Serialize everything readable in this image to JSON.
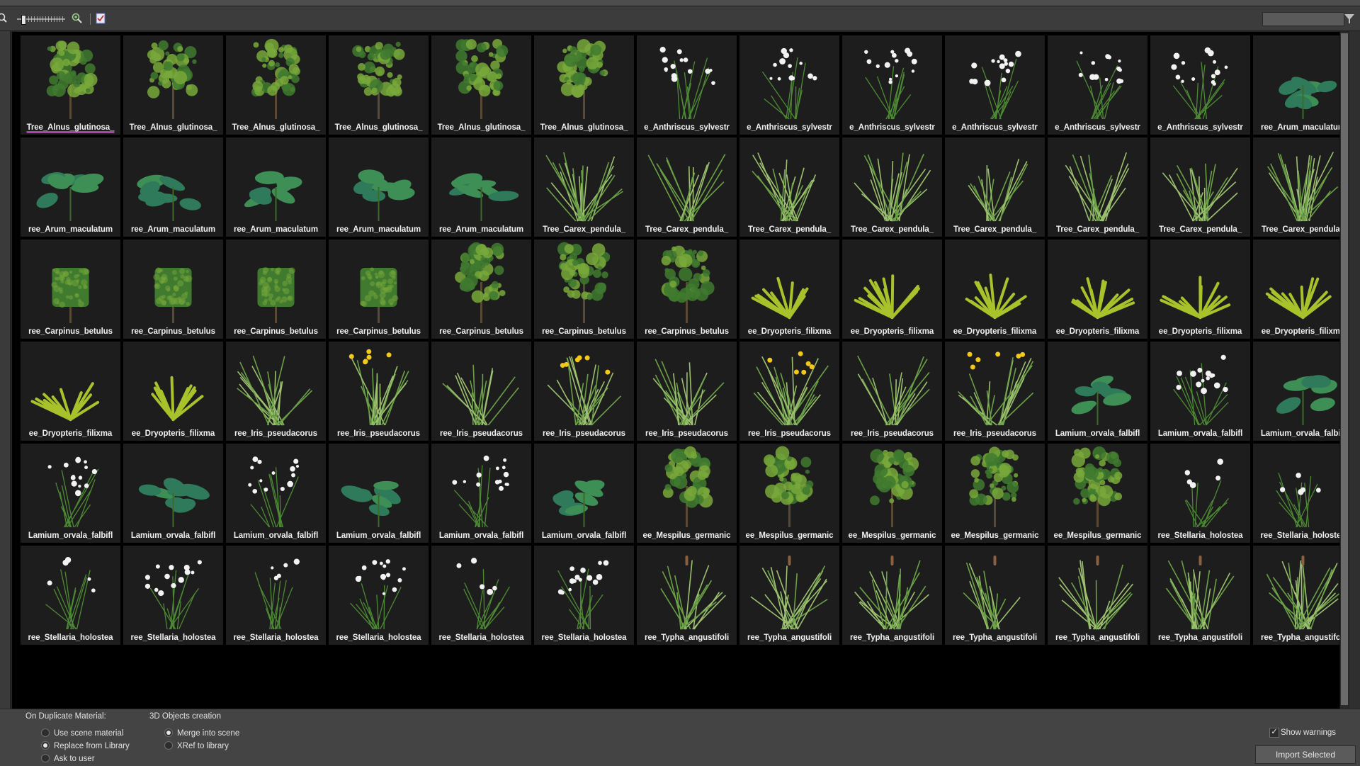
{
  "toolbar": {
    "icons": [
      "zoom-out-icon",
      "zoom-in-icon",
      "checkbox-list-icon",
      "filter-icon"
    ],
    "search": {
      "value": "",
      "placeholder": ""
    }
  },
  "grid": {
    "rows": [
      [
        {
          "label": "Tree_Alnus_glutinosa_",
          "kind": "tree",
          "selected": true
        },
        {
          "label": "Tree_Alnus_glutinosa_",
          "kind": "tree"
        },
        {
          "label": "Tree_Alnus_glutinosa_",
          "kind": "tree"
        },
        {
          "label": "Tree_Alnus_glutinosa_",
          "kind": "tree"
        },
        {
          "label": "Tree_Alnus_glutinosa_",
          "kind": "tree"
        },
        {
          "label": "Tree_Alnus_glutinosa_",
          "kind": "tree"
        },
        {
          "label": "e_Anthriscus_sylvestr",
          "kind": "flower"
        },
        {
          "label": "e_Anthriscus_sylvestr",
          "kind": "flower"
        },
        {
          "label": "e_Anthriscus_sylvestr",
          "kind": "flower"
        },
        {
          "label": "e_Anthriscus_sylvestr",
          "kind": "flower"
        },
        {
          "label": "e_Anthriscus_sylvestr",
          "kind": "flower"
        },
        {
          "label": "e_Anthriscus_sylvestr",
          "kind": "flower"
        },
        {
          "label": "ree_Arum_maculatum",
          "kind": "leafy"
        }
      ],
      [
        {
          "label": "ree_Arum_maculatum",
          "kind": "leafy"
        },
        {
          "label": "ree_Arum_maculatum",
          "kind": "leafy"
        },
        {
          "label": "ree_Arum_maculatum",
          "kind": "leafy"
        },
        {
          "label": "ree_Arum_maculatum",
          "kind": "leafy"
        },
        {
          "label": "ree_Arum_maculatum",
          "kind": "leafy"
        },
        {
          "label": "Tree_Carex_pendula_",
          "kind": "grass"
        },
        {
          "label": "Tree_Carex_pendula_",
          "kind": "grass"
        },
        {
          "label": "Tree_Carex_pendula_",
          "kind": "grass"
        },
        {
          "label": "Tree_Carex_pendula_",
          "kind": "grass"
        },
        {
          "label": "Tree_Carex_pendula_",
          "kind": "grass"
        },
        {
          "label": "Tree_Carex_pendula_",
          "kind": "grass"
        },
        {
          "label": "Tree_Carex_pendula_",
          "kind": "grass"
        },
        {
          "label": "Tree_Carex_pendula_",
          "kind": "grass"
        }
      ],
      [
        {
          "label": "ree_Carpinus_betulus",
          "kind": "hedge"
        },
        {
          "label": "ree_Carpinus_betulus",
          "kind": "hedge"
        },
        {
          "label": "ree_Carpinus_betulus",
          "kind": "hedge"
        },
        {
          "label": "ree_Carpinus_betulus",
          "kind": "hedge"
        },
        {
          "label": "ree_Carpinus_betulus",
          "kind": "tree"
        },
        {
          "label": "ree_Carpinus_betulus",
          "kind": "tree"
        },
        {
          "label": "ree_Carpinus_betulus",
          "kind": "tree"
        },
        {
          "label": "ee_Dryopteris_filixma",
          "kind": "fern"
        },
        {
          "label": "ee_Dryopteris_filixma",
          "kind": "fern"
        },
        {
          "label": "ee_Dryopteris_filixma",
          "kind": "fern"
        },
        {
          "label": "ee_Dryopteris_filixma",
          "kind": "fern"
        },
        {
          "label": "ee_Dryopteris_filixma",
          "kind": "fern"
        },
        {
          "label": "ee_Dryopteris_filixma",
          "kind": "fern"
        }
      ],
      [
        {
          "label": "ee_Dryopteris_filixma",
          "kind": "fern"
        },
        {
          "label": "ee_Dryopteris_filixma",
          "kind": "fern"
        },
        {
          "label": "ree_Iris_pseudacorus",
          "kind": "grass"
        },
        {
          "label": "ree_Iris_pseudacorus",
          "kind": "iris"
        },
        {
          "label": "ree_Iris_pseudacorus",
          "kind": "grass"
        },
        {
          "label": "ree_Iris_pseudacorus",
          "kind": "iris"
        },
        {
          "label": "ree_Iris_pseudacorus",
          "kind": "grass"
        },
        {
          "label": "ree_Iris_pseudacorus",
          "kind": "iris"
        },
        {
          "label": "ree_Iris_pseudacorus",
          "kind": "grass"
        },
        {
          "label": "ree_Iris_pseudacorus",
          "kind": "iris"
        },
        {
          "label": "Lamium_orvala_falbifl",
          "kind": "leafy"
        },
        {
          "label": "Lamium_orvala_falbifl",
          "kind": "flower"
        },
        {
          "label": "Lamium_orvala_falbifl",
          "kind": "leafy"
        }
      ],
      [
        {
          "label": "Lamium_orvala_falbifl",
          "kind": "flower"
        },
        {
          "label": "Lamium_orvala_falbifl",
          "kind": "leafy"
        },
        {
          "label": "Lamium_orvala_falbifl",
          "kind": "flower"
        },
        {
          "label": "Lamium_orvala_falbifl",
          "kind": "leafy"
        },
        {
          "label": "Lamium_orvala_falbifl",
          "kind": "flower"
        },
        {
          "label": "Lamium_orvala_falbifl",
          "kind": "leafy"
        },
        {
          "label": "ee_Mespilus_germanic",
          "kind": "tree"
        },
        {
          "label": "ee_Mespilus_germanic",
          "kind": "tree"
        },
        {
          "label": "ee_Mespilus_germanic",
          "kind": "tree"
        },
        {
          "label": "ee_Mespilus_germanic",
          "kind": "tree"
        },
        {
          "label": "ee_Mespilus_germanic",
          "kind": "tree"
        },
        {
          "label": "ree_Stellaria_holostea",
          "kind": "sparse"
        },
        {
          "label": "ree_Stellaria_holostea",
          "kind": "sparse"
        }
      ],
      [
        {
          "label": "ree_Stellaria_holostea",
          "kind": "sparse"
        },
        {
          "label": "ree_Stellaria_holostea",
          "kind": "flower"
        },
        {
          "label": "ree_Stellaria_holostea",
          "kind": "sparse"
        },
        {
          "label": "ree_Stellaria_holostea",
          "kind": "flower"
        },
        {
          "label": "ree_Stellaria_holostea",
          "kind": "sparse"
        },
        {
          "label": "ree_Stellaria_holostea",
          "kind": "flower"
        },
        {
          "label": "ree_Typha_angustifoli",
          "kind": "reed"
        },
        {
          "label": "ree_Typha_angustifoli",
          "kind": "reed"
        },
        {
          "label": "ree_Typha_angustifoli",
          "kind": "reed"
        },
        {
          "label": "ree_Typha_angustifoli",
          "kind": "reed"
        },
        {
          "label": "ree_Typha_angustifoli",
          "kind": "reed"
        },
        {
          "label": "ree_Typha_angustifoli",
          "kind": "reed"
        },
        {
          "label": "ree_Typha_angustifoli",
          "kind": "reed"
        }
      ]
    ]
  },
  "bottom": {
    "duplicate_material_title": "On Duplicate Material:",
    "objects_creation_title": "3D Objects creation",
    "duplicate_options": [
      {
        "label": "Use scene material",
        "checked": false
      },
      {
        "label": "Replace from Library",
        "checked": true
      },
      {
        "label": "Ask to user",
        "checked": false
      }
    ],
    "creation_options": [
      {
        "label": "Merge into scene",
        "checked": true
      },
      {
        "label": "XRef to library",
        "checked": false
      }
    ],
    "show_warnings_label": "Show warnings",
    "show_warnings_checked": true,
    "import_label": "Import Selected"
  },
  "colors": {
    "tile_bg": "#1d1d1d",
    "selection_underline": "#b040b0",
    "foliage": "#3f7a2f",
    "foliage_light": "#78a83a",
    "fern": "#a7c22a",
    "flower_white": "#f2f2f2",
    "flower_yellow": "#f2c81a"
  }
}
